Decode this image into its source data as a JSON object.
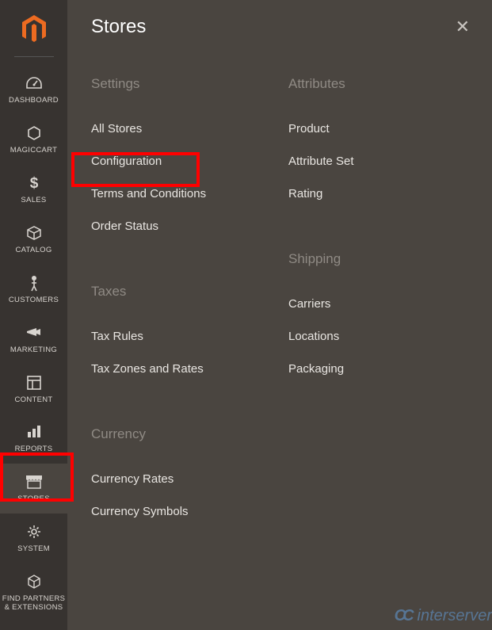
{
  "sidebar": {
    "items": [
      {
        "label": "DASHBOARD"
      },
      {
        "label": "MAGICCART"
      },
      {
        "label": "SALES"
      },
      {
        "label": "CATALOG"
      },
      {
        "label": "CUSTOMERS"
      },
      {
        "label": "MARKETING"
      },
      {
        "label": "CONTENT"
      },
      {
        "label": "REPORTS"
      },
      {
        "label": "STORES"
      },
      {
        "label": "SYSTEM"
      },
      {
        "label": "FIND PARTNERS & EXTENSIONS"
      }
    ]
  },
  "panel": {
    "title": "Stores",
    "sections": {
      "settings": {
        "title": "Settings",
        "items": [
          "All Stores",
          "Configuration",
          "Terms and Conditions",
          "Order Status"
        ]
      },
      "taxes": {
        "title": "Taxes",
        "items": [
          "Tax Rules",
          "Tax Zones and Rates"
        ]
      },
      "currency": {
        "title": "Currency",
        "items": [
          "Currency Rates",
          "Currency Symbols"
        ]
      },
      "attributes": {
        "title": "Attributes",
        "items": [
          "Product",
          "Attribute Set",
          "Rating"
        ]
      },
      "shipping": {
        "title": "Shipping",
        "items": [
          "Carriers",
          "Locations",
          "Packaging"
        ]
      }
    }
  },
  "watermark": "interserver"
}
